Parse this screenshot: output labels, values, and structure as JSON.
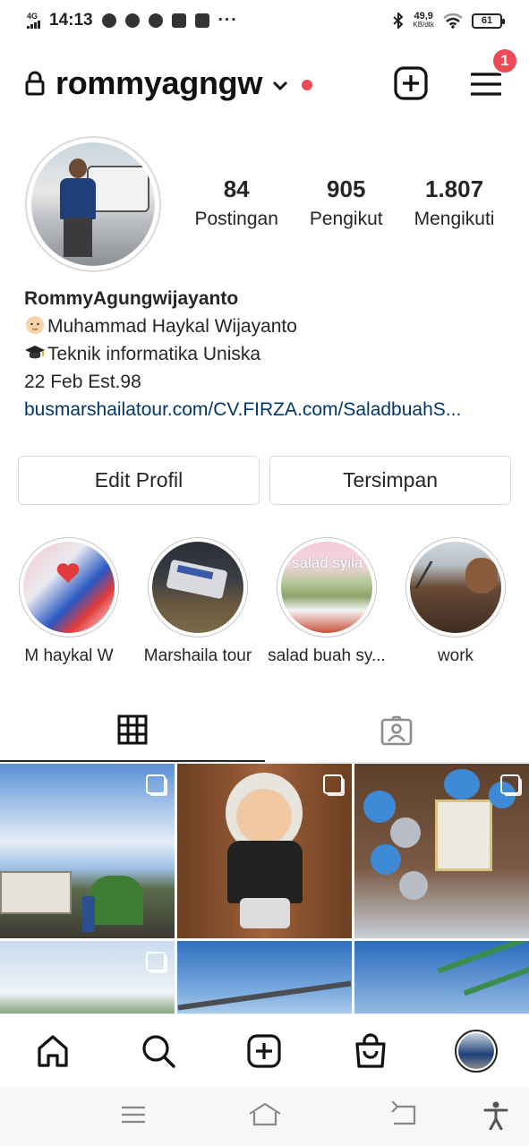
{
  "status_bar": {
    "network": "4G",
    "time": "14:13",
    "dots": "···",
    "speed_value": "49,9",
    "speed_unit": "KB/dtk",
    "battery": "61"
  },
  "header": {
    "username": "rommyagngw",
    "notification_count": "1"
  },
  "profile": {
    "stats": [
      {
        "value": "84",
        "label": "Postingan"
      },
      {
        "value": "905",
        "label": "Pengikut"
      },
      {
        "value": "1.807",
        "label": "Mengikuti"
      }
    ],
    "bio": {
      "name": "RommyAgungwijayanto",
      "line1": "Muhammad Haykal Wijayanto",
      "line2": "Teknik informatika Uniska",
      "line3": "22 Feb Est.98",
      "link": "busmarshailatour.com/CV.FIRZA.com/SaladbuahS..."
    }
  },
  "buttons": {
    "edit_profile": "Edit Profil",
    "saved": "Tersimpan"
  },
  "highlights": [
    {
      "label": "M haykal W"
    },
    {
      "label": "Marshaila tour"
    },
    {
      "label": "salad buah sy..."
    },
    {
      "label": "work"
    }
  ],
  "highlight_text": {
    "salad_title": "salad syila"
  },
  "colors": {
    "accent_red": "#ed4956",
    "link": "#00376b",
    "border": "#dbdbdb",
    "text": "#262626"
  }
}
